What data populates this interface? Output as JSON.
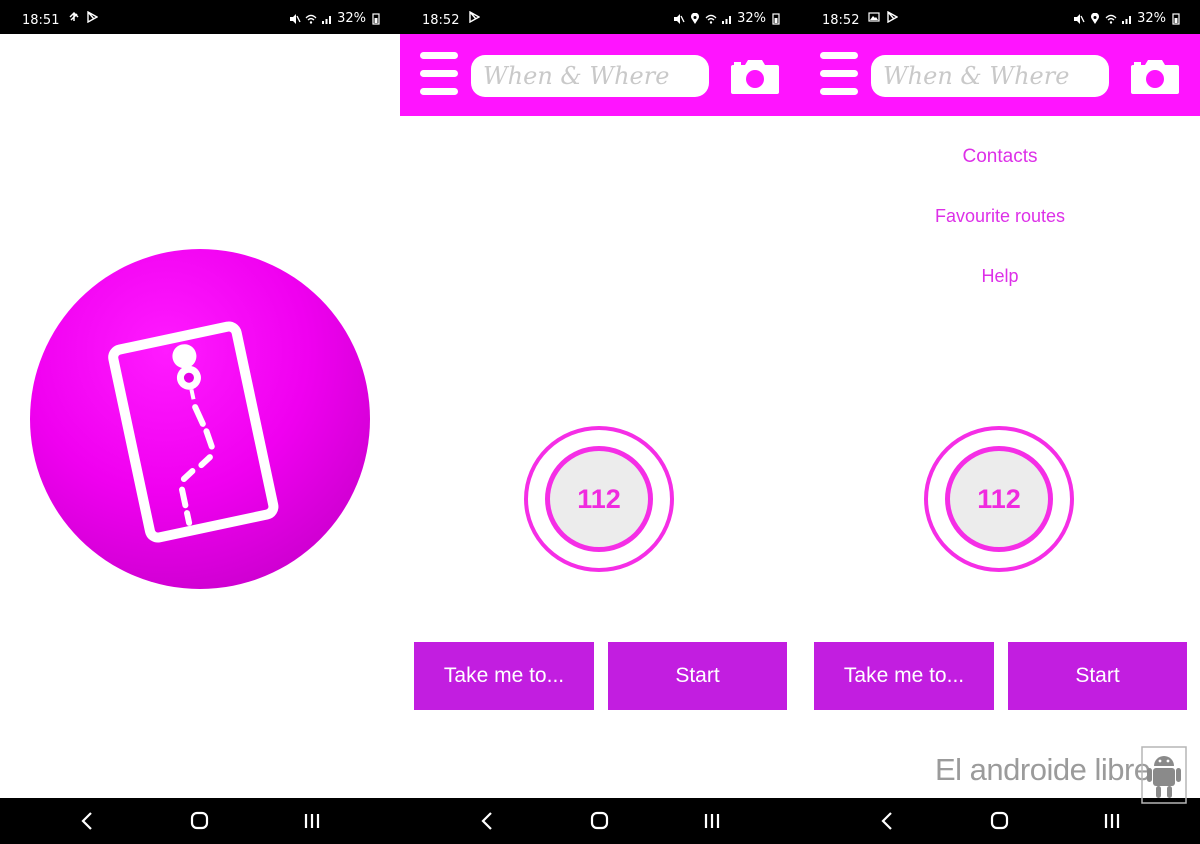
{
  "screens": [
    {
      "status": {
        "time": "18:51",
        "battery": "32%"
      }
    },
    {
      "status": {
        "time": "18:52",
        "battery": "32%"
      },
      "search": {
        "placeholder": "When & Where"
      },
      "sos": {
        "number": "112"
      },
      "buttons": {
        "take_me_to": "Take me to...",
        "start": "Start"
      }
    },
    {
      "status": {
        "time": "18:52",
        "battery": "32%"
      },
      "search": {
        "placeholder": "When & Where"
      },
      "menu": [
        "Contacts",
        "Favourite routes",
        "Help"
      ],
      "sos": {
        "number": "112"
      },
      "buttons": {
        "take_me_to": "Take me to...",
        "start": "Start"
      }
    }
  ],
  "watermark": "El androide libre",
  "icons": {
    "status_left": [
      "sync-icon",
      "play-store-icon",
      "gallery-icon",
      "location-icon"
    ],
    "status_right": [
      "mute-icon",
      "location-icon",
      "wifi-icon",
      "signal-icon",
      "battery-icon"
    ],
    "nav": [
      "back-icon",
      "home-icon",
      "recents-icon"
    ],
    "app": [
      "hamburger-menu-icon",
      "camera-icon",
      "map-route-icon"
    ]
  },
  "colors": {
    "brand_magenta": "#ff14ff",
    "button_purple": "#c21ee0",
    "menu_text": "#dd30e8",
    "sos_ring": "#f52ee6",
    "status_bar": "#000000"
  }
}
